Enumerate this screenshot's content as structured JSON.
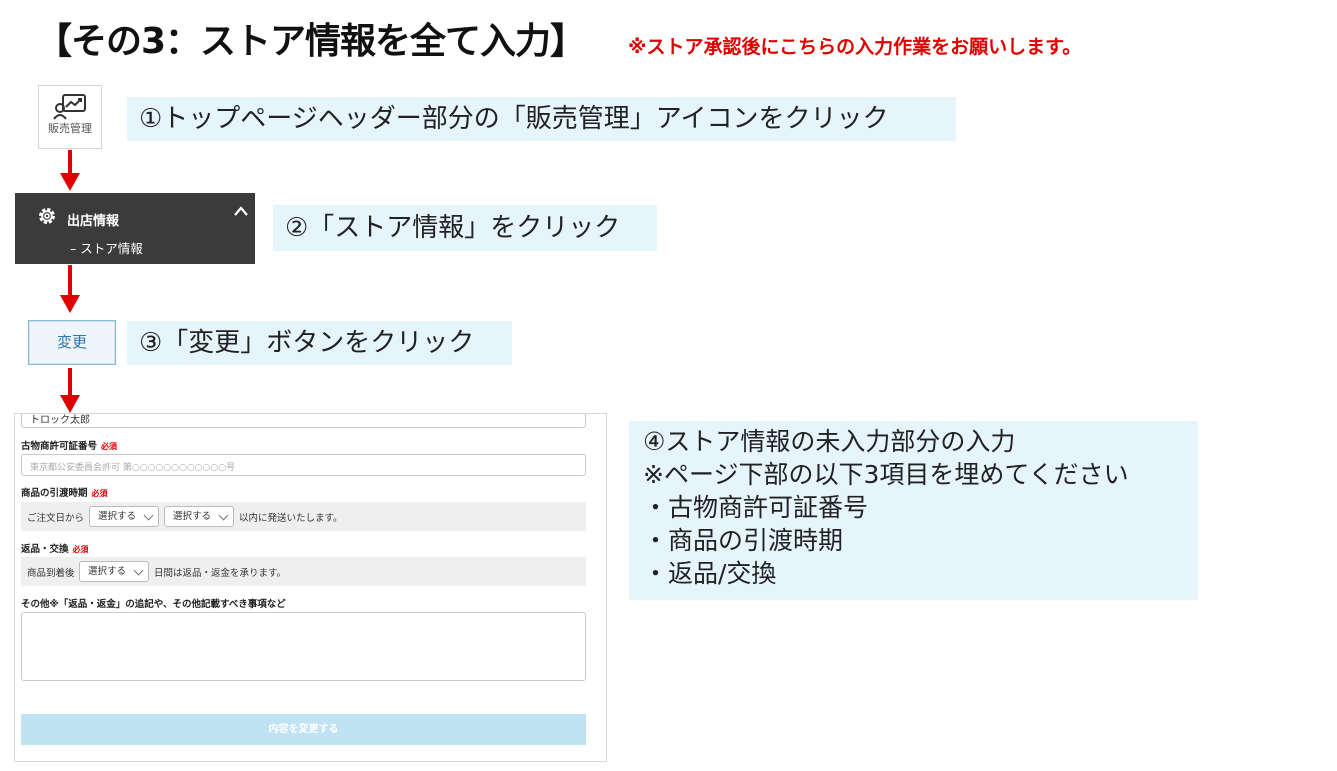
{
  "title": "【その3：ストア情報を全て入力】",
  "notice": "※ストア承認後にこちらの入力作業をお願いします。",
  "step1": {
    "icon_label": "販売管理",
    "icon_name": "sales-chart-icon",
    "instruction": "①トップページヘッダー部分の「販売管理」アイコンをクリック"
  },
  "step2": {
    "menu_title": "出店情報",
    "menu_subitem": "– ストア情報",
    "instruction": "②「ストア情報」をクリック"
  },
  "step3": {
    "button_label": "変更",
    "instruction": "③「変更」ボタンをクリック"
  },
  "form": {
    "top_field_value": "トロック太郎",
    "license": {
      "label": "古物商許可証番号",
      "required": "必須",
      "placeholder": "東京都公安委員会許可 第○○○○○○○○○○○○号"
    },
    "delivery": {
      "label": "商品の引渡時期",
      "required": "必須",
      "prefix": "ご注文日から",
      "select1": "選択する",
      "select2": "選択する",
      "suffix": "以内に発送いたします。"
    },
    "returns": {
      "label": "返品・交換",
      "required": "必須",
      "prefix": "商品到着後",
      "select": "選択する",
      "suffix": "日間は返品・返金を承ります。"
    },
    "other": {
      "label": "その他※「返品・返金」の追記や、その他記載すべき事項など"
    },
    "submit_label": "内容を変更する"
  },
  "step4": {
    "lines": [
      "④ストア情報の未入力部分の入力",
      "※ページ下部の以下3項目を埋めてください",
      "・古物商許可証番号",
      "・商品の引渡時期",
      "・返品/交換"
    ]
  },
  "colors": {
    "callout_bg": "#e6f4fb",
    "arrow": "#e00000",
    "menu_bg": "#3b3b3b",
    "notice": "#e00000"
  }
}
